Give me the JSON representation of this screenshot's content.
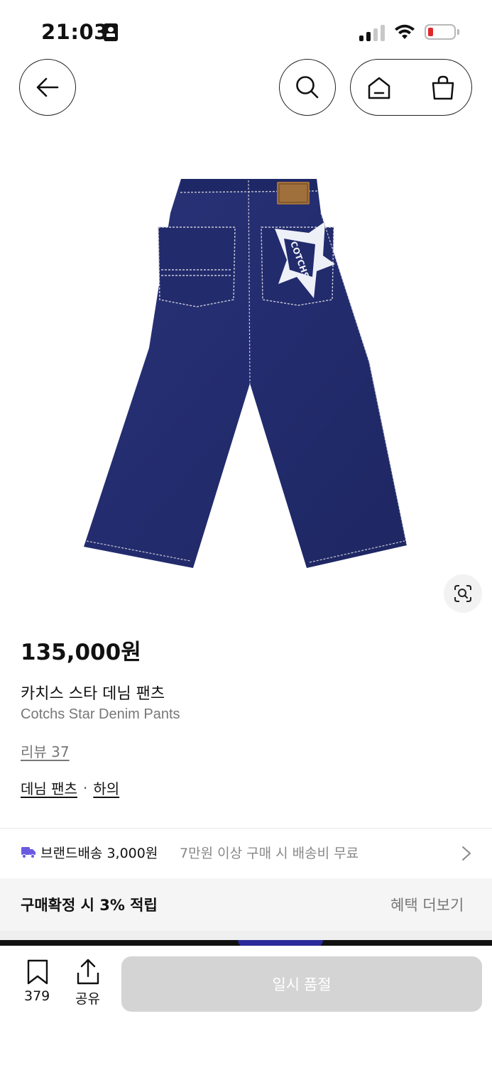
{
  "status_bar": {
    "time": "21:03",
    "icons": [
      "id-card-icon",
      "cellular-signal-icon",
      "wifi-icon",
      "battery-low-icon"
    ],
    "battery_color": "#e0282a"
  },
  "nav": {
    "icons": [
      "arrow-left-icon",
      "search-icon",
      "home-icon",
      "shopping-bag-icon"
    ]
  },
  "product": {
    "image": "dark-indigo wide-leg denim pants, back view, white star logo on back pocket",
    "price": "135,000원",
    "name_ko": "카치스 스타 데님 팬츠",
    "name_en": "Cotchs Star Denim Pants",
    "review": "리뷰 37",
    "category": [
      "데님 팬츠",
      "하의"
    ],
    "category_sep": "·",
    "lens_icon": "visual-search-icon"
  },
  "shipping": {
    "label": "브랜드배송 3,000원",
    "note": "7만원 이상 구매 시 배송비 무료",
    "icon": "truck-icon",
    "accent": "#6a5ae0"
  },
  "benefit": {
    "label": "구매확정 시 3% 적립",
    "link": "혜택 더보기"
  },
  "bottom_bar": {
    "bookmark_count": "379",
    "share_label": "공유",
    "buy_label": "일시 품절",
    "buy_bg": "#d4d4d4"
  }
}
